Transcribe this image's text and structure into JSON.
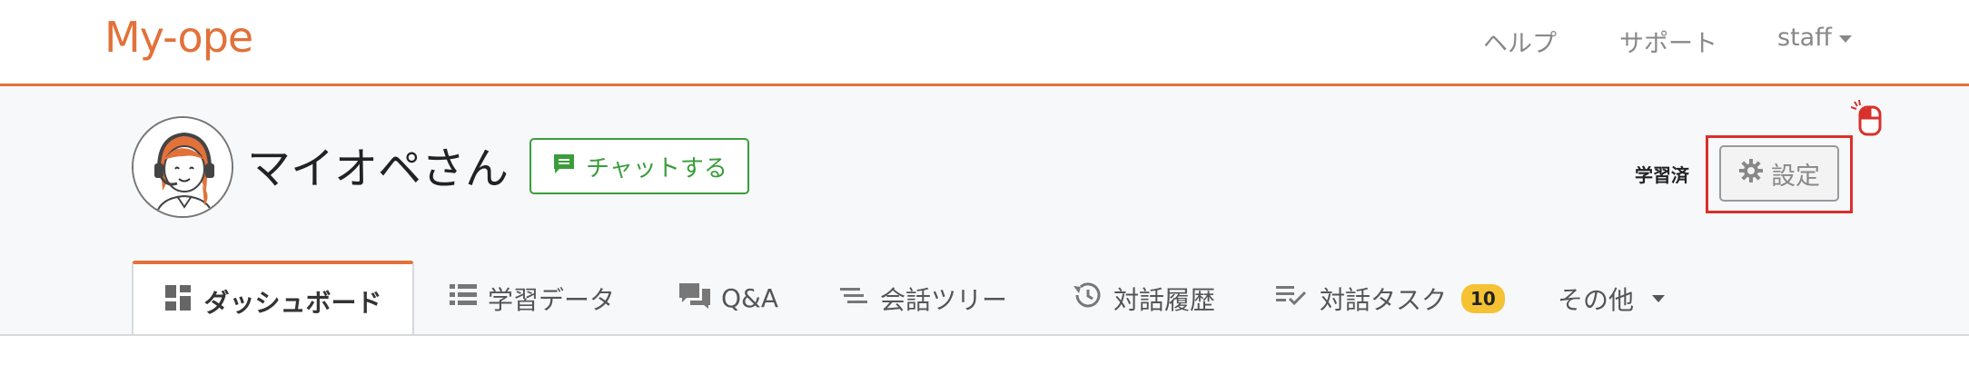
{
  "navbar": {
    "logo": "My-ope",
    "links": [
      {
        "label": "ヘルプ"
      },
      {
        "label": "サポート"
      },
      {
        "label": "staff"
      }
    ]
  },
  "bot": {
    "name": "マイオペさん",
    "chat_button": "チャットする",
    "status": "学習済",
    "settings_button": "設定"
  },
  "tabs": [
    {
      "label": "ダッシュボード",
      "icon": "dashboard-icon",
      "active": true
    },
    {
      "label": "学習データ",
      "icon": "list-icon"
    },
    {
      "label": "Q&A",
      "icon": "chat-bubbles-icon"
    },
    {
      "label": "会話ツリー",
      "icon": "tree-lines-icon"
    },
    {
      "label": "対話履歴",
      "icon": "history-icon"
    },
    {
      "label": "対話タスク",
      "icon": "task-check-icon",
      "badge": "10"
    },
    {
      "label": "その他",
      "icon": "caret-down-icon"
    }
  ],
  "colors": {
    "accent": "#e2713a",
    "chat_green": "#3a9d3a",
    "highlight_red": "#d9302c",
    "badge_yellow": "#f5c233"
  }
}
